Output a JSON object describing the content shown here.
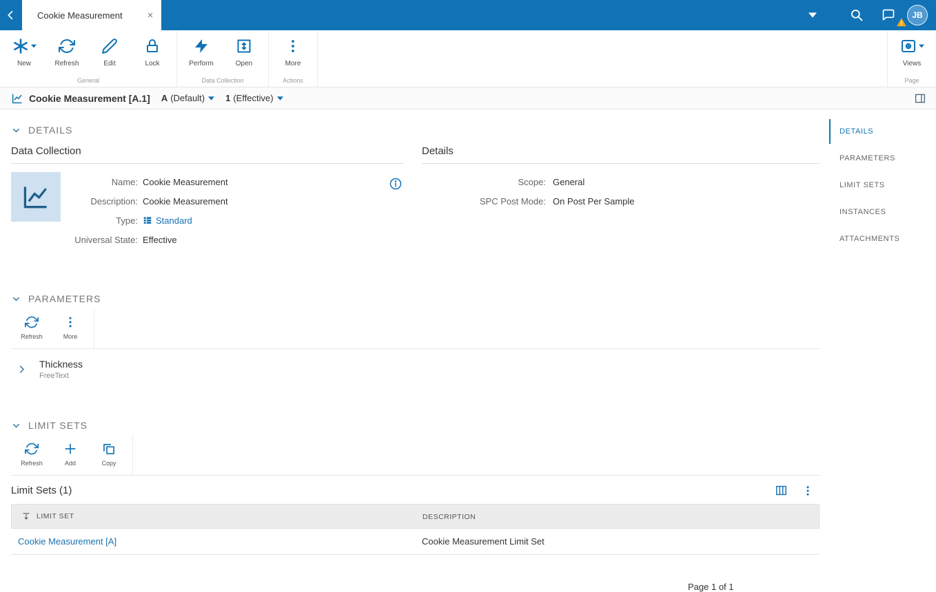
{
  "colors": {
    "topbar_blue": "#1173b5",
    "accent_blue": "#1173b5",
    "link_blue": "#1a72ad",
    "warning_yellow": "#f2a71b",
    "tile_bg": "#cfe1f0"
  },
  "topbar": {
    "tab_title": "Cookie Measurement",
    "avatar_initials": "JB"
  },
  "ribbon": {
    "buttons": {
      "new": "New",
      "refresh": "Refresh",
      "edit": "Edit",
      "lock": "Lock",
      "perform": "Perform",
      "open": "Open",
      "more": "More",
      "views": "Views"
    },
    "groups": {
      "general": "General",
      "data_collection": "Data Collection",
      "actions": "Actions",
      "page": "Page"
    }
  },
  "breadcrumb": {
    "title": "Cookie Measurement [A.1]",
    "version": "A",
    "version_state": "(Default)",
    "revision": "1",
    "revision_state": "(Effective)"
  },
  "sidebar": {
    "items": [
      {
        "label": "DETAILS",
        "active": true
      },
      {
        "label": "PARAMETERS",
        "active": false
      },
      {
        "label": "LIMIT SETS",
        "active": false
      },
      {
        "label": "INSTANCES",
        "active": false
      },
      {
        "label": "ATTACHMENTS",
        "active": false
      }
    ]
  },
  "details": {
    "section_title": "DETAILS",
    "data_collection": {
      "title": "Data Collection",
      "name_label": "Name:",
      "name_value": "Cookie Measurement",
      "description_label": "Description:",
      "description_value": "Cookie Measurement",
      "type_label": "Type:",
      "type_value": "Standard",
      "universal_state_label": "Universal State:",
      "universal_state_value": "Effective"
    },
    "details_panel": {
      "title": "Details",
      "scope_label": "Scope:",
      "scope_value": "General",
      "spc_label": "SPC Post Mode:",
      "spc_value": "On Post Per Sample"
    }
  },
  "parameters": {
    "section_title": "PARAMETERS",
    "toolbar": {
      "refresh": "Refresh",
      "more": "More"
    },
    "items": [
      {
        "name": "Thickness",
        "type": "FreeText"
      }
    ]
  },
  "limit_sets": {
    "section_title": "LIMIT SETS",
    "toolbar": {
      "refresh": "Refresh",
      "add": "Add",
      "copy": "Copy"
    },
    "grid_title": "Limit Sets (1)",
    "columns": {
      "limit_set": "LIMIT SET",
      "description": "DESCRIPTION"
    },
    "rows": [
      {
        "limit_set": "Cookie Measurement [A]",
        "description": "Cookie Measurement Limit Set"
      }
    ]
  },
  "footer": {
    "page_text": "Page 1 of 1"
  },
  "icons": [
    "back-chevron",
    "close",
    "dropdown-caret",
    "search",
    "feedback-bubble",
    "avatar-warning",
    "new-asterisk",
    "refresh",
    "edit-pencil",
    "lock",
    "perform-lightning",
    "open-box",
    "more-ellipsis",
    "views-eye",
    "line-chart",
    "panel-toggle",
    "section-chevron",
    "info",
    "type-table",
    "expand-chevron",
    "add-plus",
    "copy",
    "choose-columns",
    "grid-more",
    "limit-sort"
  ]
}
